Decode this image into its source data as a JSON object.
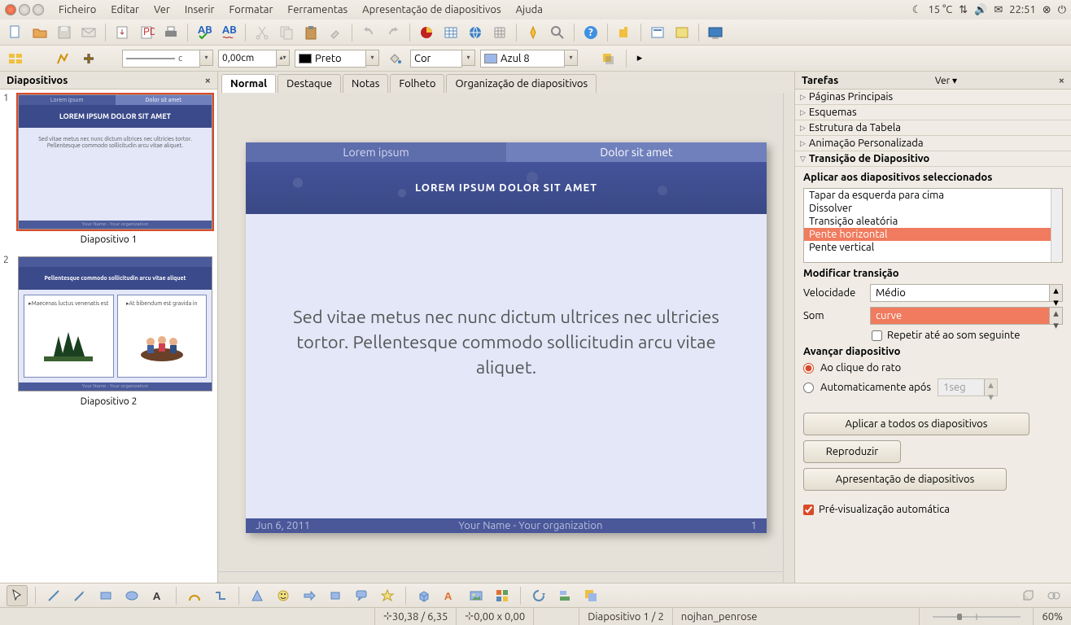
{
  "menubar": {
    "items": [
      "Ficheiro",
      "Editar",
      "Ver",
      "Inserir",
      "Formatar",
      "Ferramentas",
      "Apresentação de diapositivos",
      "Ajuda"
    ],
    "temp": "15 °C",
    "clock": "22:51"
  },
  "toolbar2": {
    "line_style": "c",
    "line_width": "0,00cm",
    "line_color_label": "Preto",
    "fill_mode": "Cor",
    "fill_color_label": "Azul 8"
  },
  "slides_panel": {
    "title": "Diapositivos",
    "items": [
      {
        "num": "1",
        "caption": "Diapositivo 1",
        "tab_l": "Lorem ipsum",
        "tab_r": "Dolor sit amet",
        "title": "LOREM IPSUM DOLOR SIT AMET",
        "body": "Sed vitae metus nec nunc dictum ultrices nec ultricies tortor. Pellentesque commodo sollicitudin arcu vitae aliquet."
      },
      {
        "num": "2",
        "caption": "Diapositivo 2",
        "title": "Pellentesque commodo sollicitudin arcu vitae aliquet",
        "col1": "▸Maecenas luctus venenatis est",
        "col2": "▸At bibendum est gravida in"
      }
    ]
  },
  "view_tabs": [
    "Normal",
    "Destaque",
    "Notas",
    "Folheto",
    "Organização de diapositivos"
  ],
  "slide": {
    "tab_l": "Lorem ipsum",
    "tab_r": "Dolor sit amet",
    "title": "LOREM IPSUM DOLOR SIT AMET",
    "body": "Sed vitae metus nec nunc dictum ultrices nec ultricies tortor. Pellentesque commodo sollicitudin arcu vitae aliquet.",
    "foot_date": "Jun 6, 2011",
    "foot_author": "Your Name - Your organization",
    "foot_num": "1"
  },
  "tasks": {
    "title": "Tarefas",
    "ver": "Ver  ▾",
    "sections": {
      "a": "Páginas Principais",
      "b": "Esquemas",
      "c": "Estrutura da Tabela",
      "d": "Animação Personalizada",
      "e": "Transição de Diapositivo"
    },
    "apply_label": "Aplicar aos diapositivos seleccionados",
    "transitions": [
      "Tapar da esquerda para cima",
      "Dissolver",
      "Transição aleatória",
      "Pente horizontal",
      "Pente vertical"
    ],
    "transitions_selected": "Pente horizontal",
    "modify": "Modificar transição",
    "speed_label": "Velocidade",
    "speed_value": "Médio",
    "sound_label": "Som",
    "sound_value": "curve",
    "repeat_label": "Repetir até ao som seguinte",
    "advance": "Avançar diapositivo",
    "onclick": "Ao clique do rato",
    "auto_after": "Automaticamente após",
    "auto_value": "1seg",
    "apply_all": "Aplicar a todos os diapositivos",
    "play": "Reproduzir",
    "slideshow": "Apresentação de diapositivos",
    "auto_preview": "Pré-visualização automática"
  },
  "statusbar": {
    "coords": "30,38 / 6,35",
    "size": "0,00 x 0,00",
    "slide_info": "Diapositivo 1 / 2",
    "template": "nojhan_penrose",
    "zoom": "60%"
  }
}
